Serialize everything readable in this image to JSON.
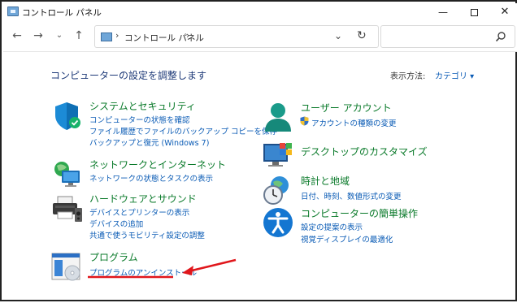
{
  "window": {
    "title": "コントロール パネル",
    "minimize": "—",
    "close": "✕"
  },
  "nav": {
    "back": "←",
    "forward": "→",
    "recent": "⌄",
    "up": "↑"
  },
  "address": {
    "sep": "›",
    "path": "コントロール パネル",
    "dropdown": "⌄",
    "refresh": "↻"
  },
  "search": {
    "placeholder": ""
  },
  "header": {
    "title": "コンピューターの設定を調整します",
    "view_by_label": "表示方法:",
    "view_by_value": "カテゴリ ▾"
  },
  "categories": [
    {
      "title": "システムとセキュリティ",
      "links": [
        "コンピューターの状態を確認",
        "ファイル履歴でファイルのバックアップ コピーを保存",
        "バックアップと復元 (Windows 7)"
      ]
    },
    {
      "title": "ネットワークとインターネット",
      "links": [
        "ネットワークの状態とタスクの表示"
      ]
    },
    {
      "title": "ハードウェアとサウンド",
      "links": [
        "デバイスとプリンターの表示",
        "デバイスの追加",
        "共通で使うモビリティ設定の調整"
      ]
    },
    {
      "title": "プログラム",
      "links": [
        "プログラムのアンインストール"
      ]
    },
    {
      "title": "ユーザー アカウント",
      "links": [
        "アカウントの種類の変更"
      ]
    },
    {
      "title": "デスクトップのカスタマイズ",
      "links": []
    },
    {
      "title": "時計と地域",
      "links": [
        "日付、時刻、数値形式の変更"
      ]
    },
    {
      "title": "コンピューターの簡単操作",
      "links": [
        "設定の提案の表示",
        "視覚ディスプレイの最適化"
      ]
    }
  ],
  "colors": {
    "category_title": "#0a7a2a",
    "link": "#0a5bb5",
    "header": "#1e3a78",
    "annotation": "#e0161b"
  }
}
